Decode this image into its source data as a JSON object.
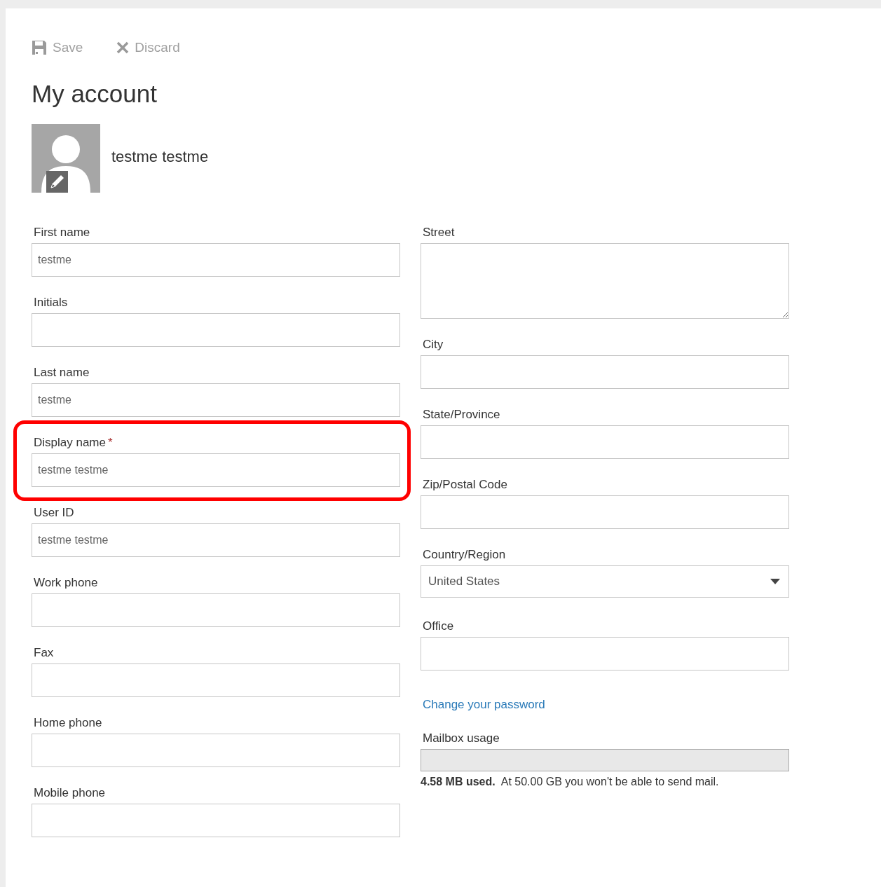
{
  "toolbar": [
    {
      "kind": "save",
      "label": "Save",
      "disabled": true
    },
    {
      "kind": "discard",
      "label": "Discard",
      "disabled": true
    }
  ],
  "title": "My account",
  "profile": {
    "name": "testme testme"
  },
  "left_fields": [
    {
      "kind": "text",
      "label": "First name",
      "value": "testme",
      "highlighted": false
    },
    {
      "kind": "text",
      "label": "Initials",
      "highlighted": false
    },
    {
      "kind": "text",
      "label": "Last name",
      "value": "testme",
      "highlighted": false
    },
    {
      "kind": "text",
      "label": "Display name",
      "required_mark": "*",
      "value": "testme testme",
      "highlighted": true
    },
    {
      "kind": "text",
      "label": "User ID",
      "value": "testme testme",
      "highlighted": false
    },
    {
      "kind": "text",
      "label": "Work phone",
      "highlighted": false
    },
    {
      "kind": "text",
      "label": "Fax",
      "highlighted": false
    },
    {
      "kind": "text",
      "label": "Home phone",
      "highlighted": false
    },
    {
      "kind": "text",
      "label": "Mobile phone",
      "highlighted": false
    }
  ],
  "right_fields": [
    {
      "kind": "textarea",
      "label": "Street"
    },
    {
      "kind": "text",
      "label": "City"
    },
    {
      "kind": "text",
      "label": "State/Province"
    },
    {
      "kind": "text",
      "label": "Zip/Postal Code"
    },
    {
      "kind": "select",
      "label": "Country/Region",
      "value": "United States"
    },
    {
      "kind": "text",
      "label": "Office"
    }
  ],
  "password_link": "Change your password",
  "mailbox": {
    "label": "Mailbox usage",
    "level": 0,
    "summary": "**4.58 MB used.**  At 50.00 GB you won't be able to send mail."
  }
}
